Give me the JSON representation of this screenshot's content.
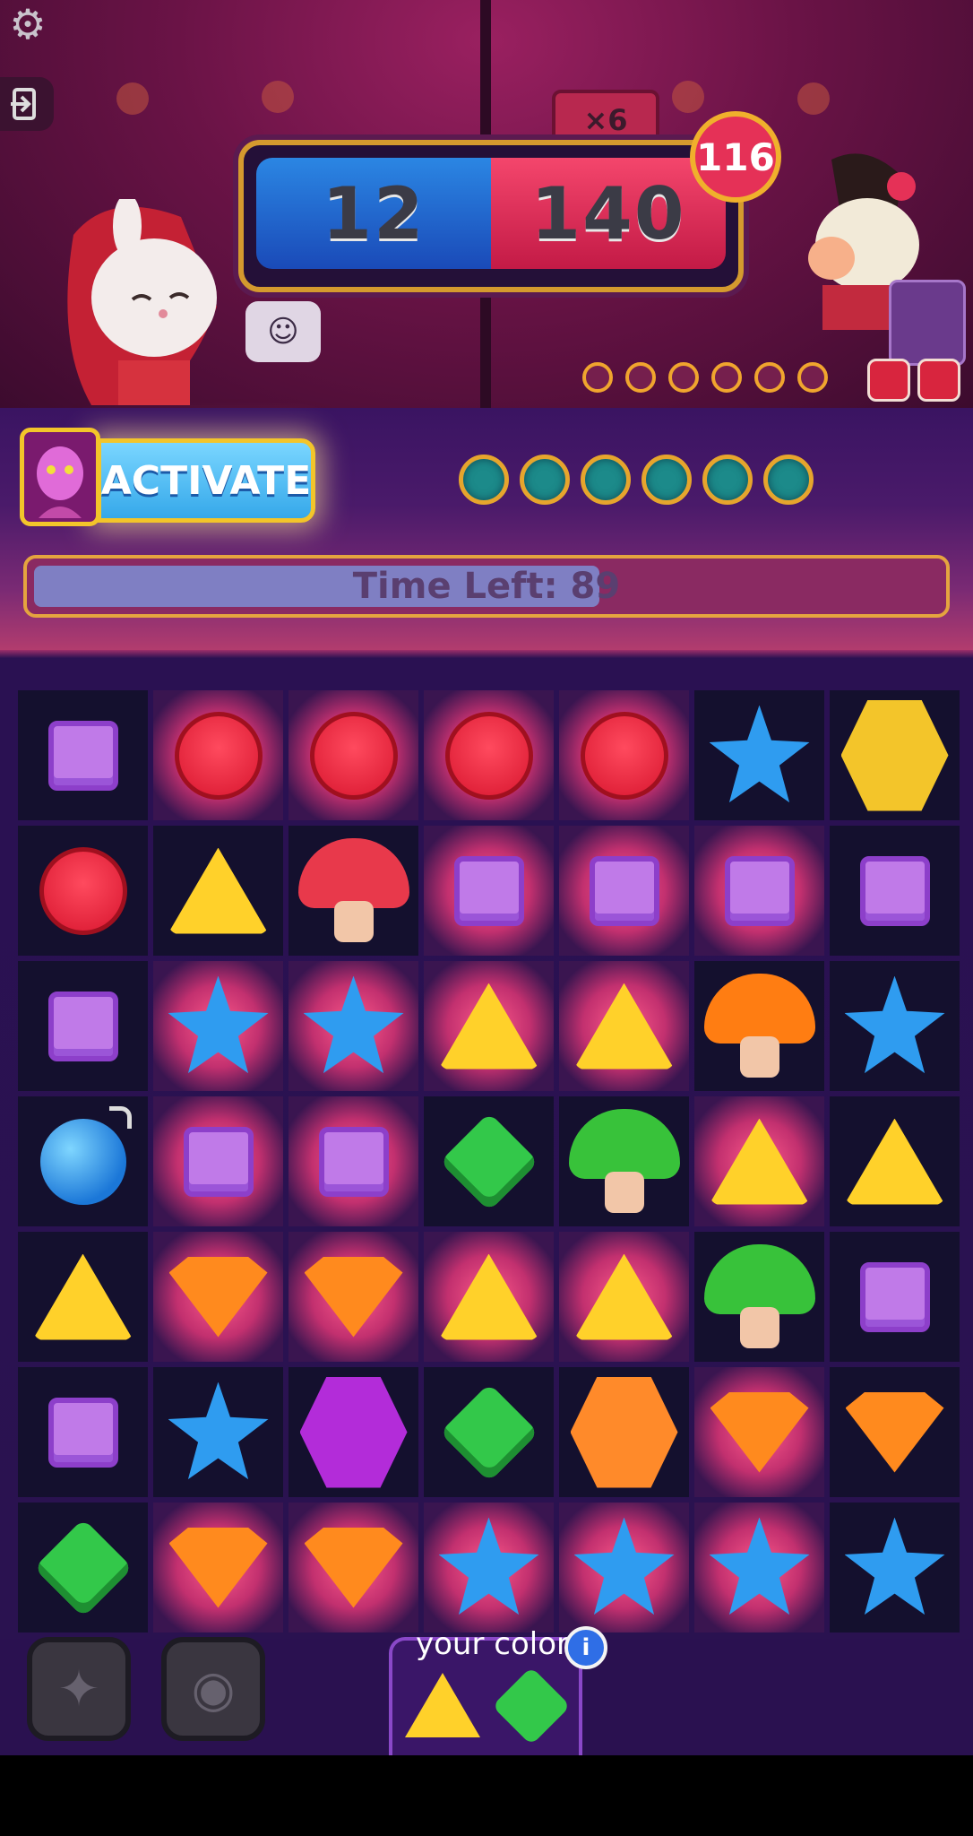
{
  "scores": {
    "player": "12",
    "opponent": "140",
    "multiplier": "×6",
    "opponent_total": "116"
  },
  "control": {
    "activate_label": "ACTIVATE",
    "timer_text": "Time Left: 89",
    "timer_fill_fraction": 0.62
  },
  "board": {
    "rows": [
      [
        "square",
        "circle",
        "circle",
        "circle",
        "circle",
        "star",
        "hex-gold"
      ],
      [
        "circle",
        "triangle",
        "mushroom-red",
        "square",
        "square",
        "square",
        "square"
      ],
      [
        "square",
        "star",
        "star",
        "triangle",
        "triangle",
        "mushroom-orange",
        "star"
      ],
      [
        "bomb",
        "square",
        "square",
        "diamond",
        "mushroom-green",
        "triangle",
        "triangle"
      ],
      [
        "triangle",
        "shield",
        "shield",
        "triangle",
        "triangle",
        "mushroom-green",
        "square"
      ],
      [
        "square",
        "star",
        "hex-purple",
        "diamond",
        "hex-orange",
        "shield",
        "shield"
      ],
      [
        "diamond",
        "shield",
        "shield",
        "star",
        "star",
        "star",
        "star"
      ]
    ]
  },
  "bottom": {
    "colors_label": "your colors",
    "info_label": "i"
  },
  "colors": {
    "accent_gold": "#f3c52a",
    "player_blue": "#2b86e3",
    "opponent_red": "#f4466c"
  }
}
